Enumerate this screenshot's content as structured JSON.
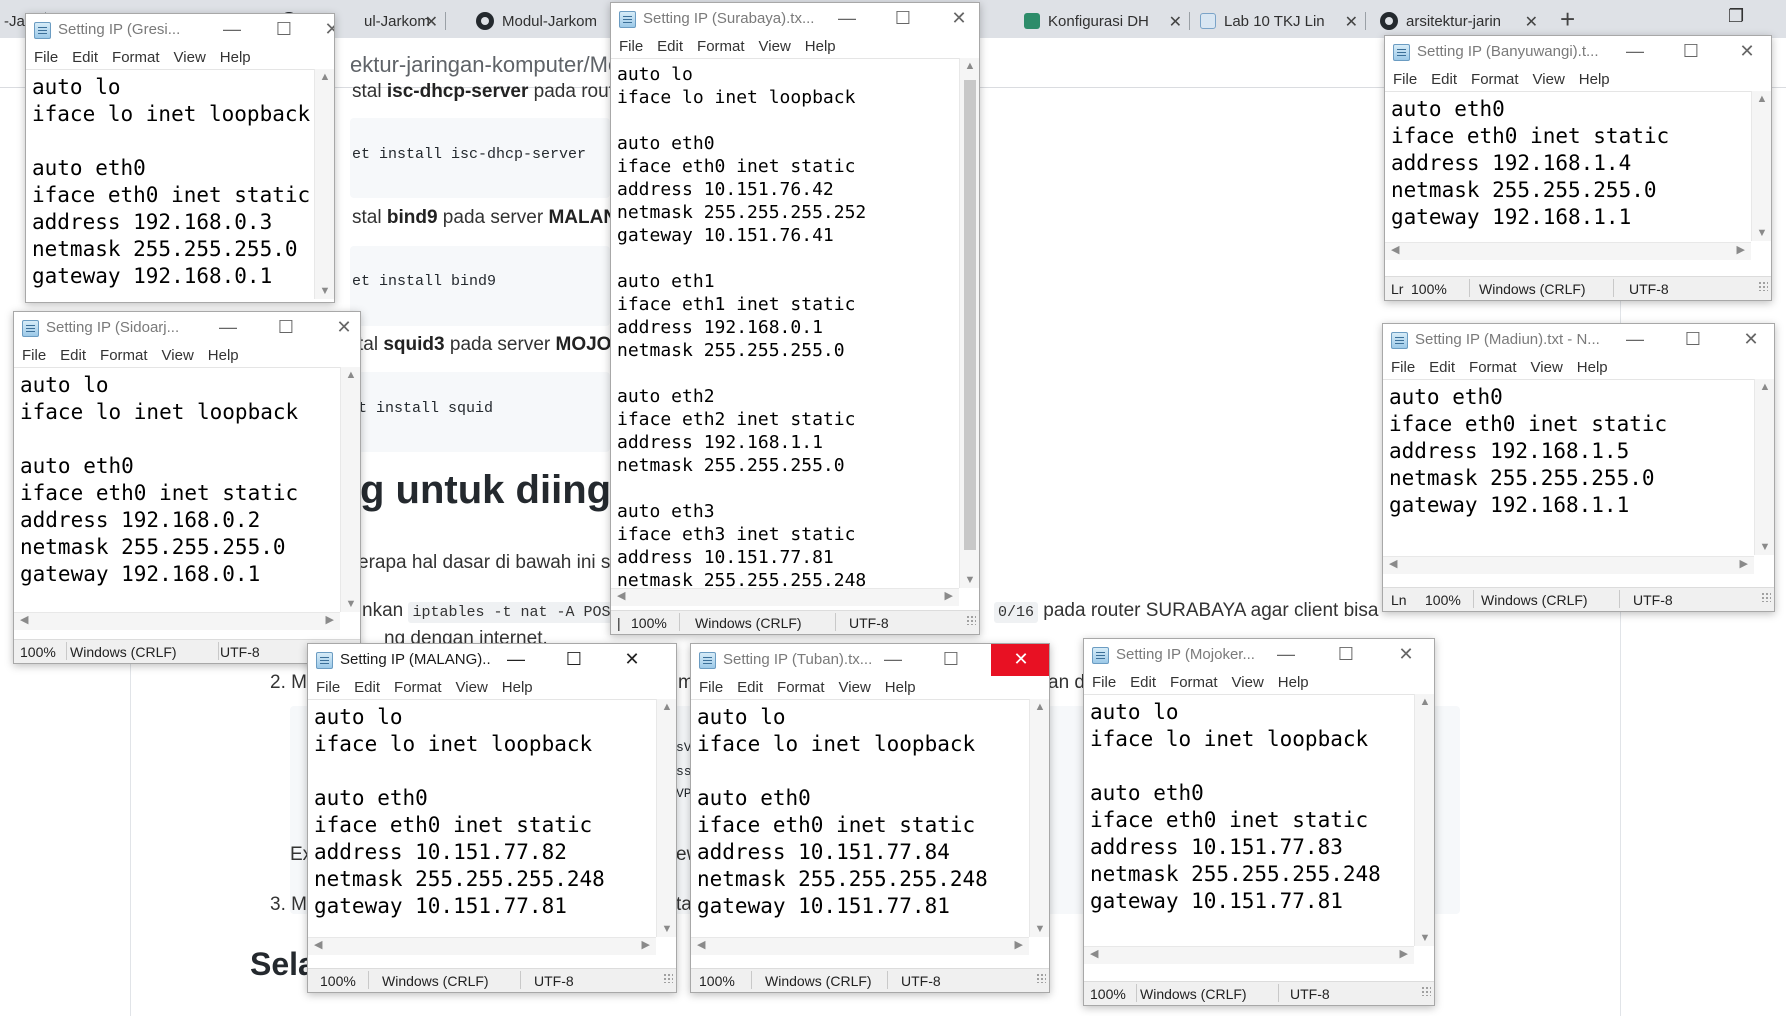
{
  "browser": {
    "tabs": [
      {
        "label": "-Jar",
        "icon": "none"
      },
      {
        "label": "ul-Jarkom",
        "icon": "github-icon"
      },
      {
        "label": "Modul-Jarkom",
        "icon": "github-icon"
      },
      {
        "label": "Konfigurasi DH",
        "icon": "page-icon"
      },
      {
        "label": "Lab 10 TKJ Lin",
        "icon": "page-icon"
      },
      {
        "label": "arsitektur-jarin",
        "icon": "github-icon"
      }
    ],
    "url": "ektur-jaringan-komputer/Mod"
  },
  "doc": {
    "line1_pre": "stal ",
    "line1_bold": "isc-dhcp-server",
    "line1_post": " pada route",
    "code1": "et install isc-dhcp-server",
    "line2_pre": "stal ",
    "line2_bold": "bind9",
    "line2_mid": " pada server ",
    "line2_bold2": "MALAN",
    "code2": "et install bind9",
    "line3_pre": "tal ",
    "line3_bold": "squid3",
    "line3_mid": " pada server ",
    "line3_bold2": "MOJOK",
    "code3": "t install squid",
    "heading": "g untuk diinga",
    "para1": "erapa hal dasar di bawah ini se",
    "para2_pre": "nkan ",
    "para2_code": "iptables -t nat -A POSTR",
    "para2_code2": "0/16",
    "para2_post": " pada router SURABAYA agar client bisa",
    "para3": "ng dengan internet.",
    "item2_num": "2. M",
    "item2_tail": "an d",
    "item3_num": "3. M",
    "ex_label": "Ex",
    "heading2": "Selan",
    "frag_me": "me",
    "frag_svi": "sVI",
    "frag_ss": "ss",
    "frag_vp": "VPI",
    "frag_ew": "ew",
    "frag_ta": "ta"
  },
  "statusbar": {
    "zoom": "100%",
    "eol": "Windows (CRLF)",
    "enc": "UTF-8",
    "ln_prefix": "Ln",
    "ln_prefix_short": "Lr",
    "cursor_prefix": "|"
  },
  "menu": {
    "file": "File",
    "edit": "Edit",
    "format": "Format",
    "view": "View",
    "help": "Help"
  },
  "windows": {
    "gresik": {
      "title": "Setting IP (Gresi...",
      "content": "auto lo\niface lo inet loopback\n\nauto eth0\niface eth0 inet static\naddress 192.168.0.3\nnetmask 255.255.255.0\ngateway 192.168.0.1"
    },
    "surabaya": {
      "title": "Setting IP (Surabaya).tx...",
      "content": "auto lo\niface lo inet loopback\n\nauto eth0\niface eth0 inet static\naddress 10.151.76.42\nnetmask 255.255.255.252\ngateway 10.151.76.41\n\nauto eth1\niface eth1 inet static\naddress 192.168.0.1\nnetmask 255.255.255.0\n\nauto eth2\niface eth2 inet static\naddress 192.168.1.1\nnetmask 255.255.255.0\n\nauto eth3\niface eth3 inet static\naddress 10.151.77.81\nnetmask 255.255.255.248"
    },
    "banyuwangi": {
      "title": "Setting IP (Banyuwangi).t...",
      "content": "auto eth0\niface eth0 inet static\naddress 192.168.1.4\nnetmask 255.255.255.0\ngateway 192.168.1.1"
    },
    "sidoarjo": {
      "title": "Setting IP (Sidoarj...",
      "content": "auto lo\niface lo inet loopback\n\nauto eth0\niface eth0 inet static\naddress 192.168.0.2\nnetmask 255.255.255.0\ngateway 192.168.0.1"
    },
    "madiun": {
      "title": "Setting IP (Madiun).txt - N...",
      "content": "auto eth0\niface eth0 inet static\naddress 192.168.1.5\nnetmask 255.255.255.0\ngateway 192.168.1.1"
    },
    "malang": {
      "title": "Setting IP (MALANG)....",
      "content": "auto lo\niface lo inet loopback\n\nauto eth0\niface eth0 inet static\naddress 10.151.77.82\nnetmask 255.255.255.248\ngateway 10.151.77.81"
    },
    "tuban": {
      "title": "Setting IP (Tuban).tx...",
      "content": "auto lo\niface lo inet loopback\n\nauto eth0\niface eth0 inet static\naddress 10.151.77.84\nnetmask 255.255.255.248\ngateway 10.151.77.81"
    },
    "mojokerto": {
      "title": "Setting IP (Mojoker...",
      "content": "auto lo\niface lo inet loopback\n\nauto eth0\niface eth0 inet static\naddress 10.151.77.83\nnetmask 255.255.255.248\ngateway 10.151.77.81"
    }
  },
  "icons": {
    "minimize": "minimize-icon",
    "maximize": "maximize-icon",
    "close": "close-icon"
  },
  "colors": {
    "close_hover": "#e81123",
    "tabstrip": "#dee1e6"
  }
}
